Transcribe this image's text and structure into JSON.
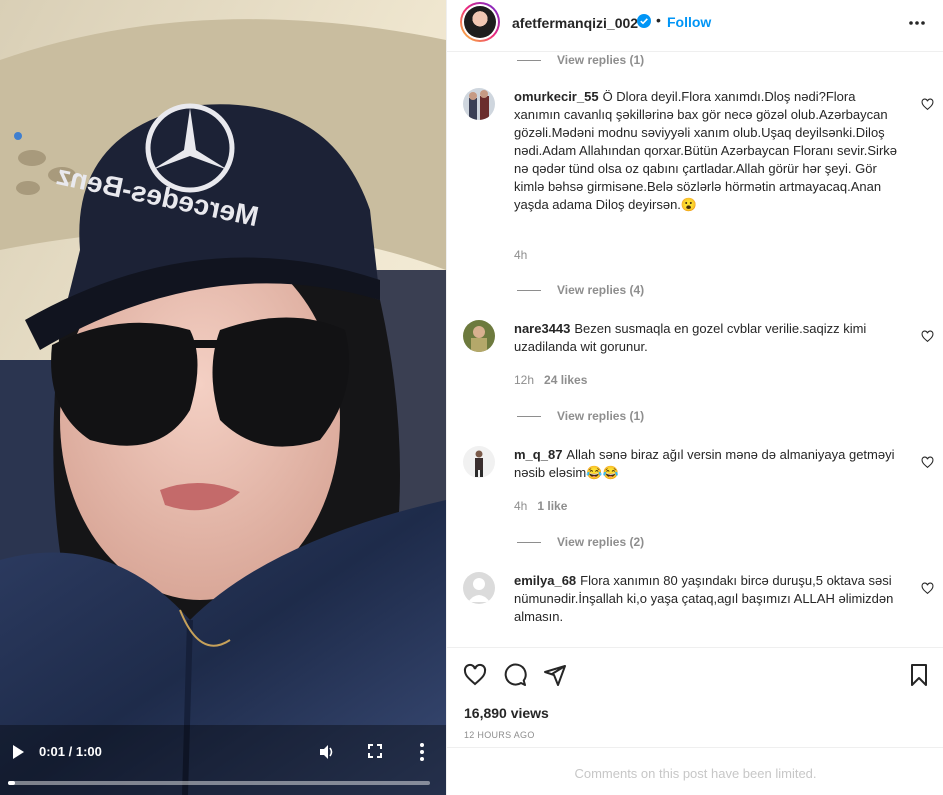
{
  "video": {
    "time_label": "0:01 / 1:00",
    "progress": 0.017,
    "icons": {
      "play": "play-icon",
      "volume": "volume-icon",
      "fullscreen": "fullscreen-icon",
      "more": "more-vertical-icon"
    }
  },
  "header": {
    "username": "afetfermanqizi_002",
    "separator": "•",
    "follow_label": "Follow",
    "verified_color": "#0095f6"
  },
  "comments": [
    {
      "kind": "replies",
      "label": "View replies (1)"
    },
    {
      "kind": "comment",
      "username": "omurkecir_55",
      "text": "Ö Dlora deyil.Flora xanımdı.Dloş nədi?Flora xanımın cavanlıq şəkillərinə bax gör necə gözəl olub.Azərbaycan gözəli.Mədəni modnu səviyyəli xanım olub.Uşaq deyilsənki.Diloş nədi.Adam Allahından qorxar.Bütün Azərbaycan Floranı sevir.Sirkə nə qədər tünd olsa oz qabını çartladar.Allah görür hər şeyi. Gör kimlə bəhsə girmisəne.Belə sözlərlə hörmətin artmayacaq.Anan yaşda adama Diloş deyirsən.😮",
      "time": "4h",
      "likes": "",
      "replies": "View replies (4)"
    },
    {
      "kind": "comment",
      "username": "nare3443",
      "text": "Bezen susmaqla en gozel cvblar verilie.saqizz kimi uzadilanda wit gorunur.",
      "time": "12h",
      "likes": "24 likes",
      "replies": "View replies (1)"
    },
    {
      "kind": "comment",
      "username": "m_q_87",
      "text": "Allah sənə biraz ağıl versin mənə də almaniyaya getməyi nəsib eləsim😂😂",
      "time": "4h",
      "likes": "1 like",
      "replies": "View replies (2)"
    },
    {
      "kind": "comment",
      "username": "emilya_68",
      "text": "Flora xanımın 80 yaşındakı bircə duruşu,5 oktava səsi nümunədir.İnşallah ki,o yaşa çataq,agıl başımızı ALLAH əlimizdən almasın."
    }
  ],
  "actions": {
    "icons": [
      "heart-icon",
      "comment-icon",
      "share-icon",
      "bookmark-icon"
    ],
    "views": "16,890 views",
    "posted": "12 HOURS AGO"
  },
  "footer": {
    "notice": "Comments on this post have been limited."
  }
}
